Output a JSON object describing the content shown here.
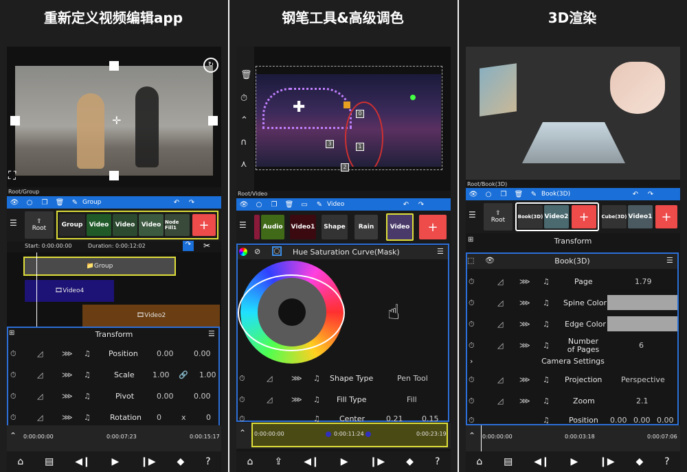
{
  "captions": [
    "重新定义视频编辑app",
    "钢笔工具&高级调色",
    "3D渲染"
  ],
  "colors": {
    "toolbar": "#1a6fd8",
    "accent_blue": "#3d8ee8",
    "add_red": "#ee4b4b",
    "group_yellow": "#e0e03a"
  },
  "p1": {
    "breadcrumb": "Root/Group",
    "toolbar_title": "Group",
    "root_label": "Root",
    "chips": [
      "Group",
      "Video",
      "Video",
      "Video",
      "Node Fill1"
    ],
    "start_label": "Start: 0:00:00:00",
    "duration_label": "Duration: 0:00:12:02",
    "tracks": [
      "Group",
      "Video4",
      "Video2"
    ],
    "transform_title": "Transform",
    "props": [
      {
        "name": "Position",
        "v1": "0.00",
        "v2": "0.00",
        "sep": ""
      },
      {
        "name": "Scale",
        "v1": "1.00",
        "v2": "1.00",
        "sep": "🔗"
      },
      {
        "name": "Pivot",
        "v1": "0.00",
        "v2": "0.00",
        "sep": ""
      },
      {
        "name": "Rotation",
        "v1": "0",
        "v2": "0",
        "sep": "x"
      }
    ],
    "time_start": "0:00:00:00",
    "time_mid": "0:00:07:23",
    "time_end": "0:00:15:17"
  },
  "p2": {
    "breadcrumb": "Root/Video",
    "toolbar_title": "Video",
    "chips": [
      "Audio",
      "Video1",
      "Shape",
      "Rain",
      "Video"
    ],
    "panel_title": "Hue Saturation Curve(Mask)",
    "point_labels": [
      "0",
      "1",
      "2",
      "3"
    ],
    "props": [
      {
        "name": "Shape Type",
        "value": "Pen Tool"
      },
      {
        "name": "Fill Type",
        "value": "Fill"
      },
      {
        "name": "Center",
        "v1": "0.21",
        "v2": "0.15"
      }
    ],
    "time_start": "0:00:00:00",
    "time_mid": "0:00:11:24",
    "time_end": "0:00:23:19"
  },
  "p3": {
    "breadcrumb": "Root/Book(3D)",
    "toolbar_title": "Book(3D)",
    "root_label": "Root",
    "chips": [
      "Book(3D)",
      "Video2",
      "Cube(3D)",
      "Video1"
    ],
    "transform_title": "Transform",
    "section_title": "Book(3D)",
    "props": [
      {
        "name": "Page",
        "value": "1.79"
      },
      {
        "name": "Spine Color",
        "value": ""
      },
      {
        "name": "Edge Color",
        "value": ""
      },
      {
        "name": "Number of Pages",
        "value": "6"
      }
    ],
    "camera_label": "Camera Settings",
    "props2": [
      {
        "name": "Projection",
        "value": "Perspective"
      },
      {
        "name": "Zoom",
        "value": "2.1"
      },
      {
        "name": "Position",
        "v1": "0.00",
        "v2": "0.00",
        "v3": "0.00"
      }
    ],
    "time_start": "0:00:00:00",
    "time_mid": "0:00:03:18",
    "time_end": "0:00:07:06"
  },
  "nav": {
    "home": "⌂",
    "prev": "◀❙",
    "play": "▶",
    "next": "❙▶",
    "gem": "◆",
    "help": "?"
  }
}
